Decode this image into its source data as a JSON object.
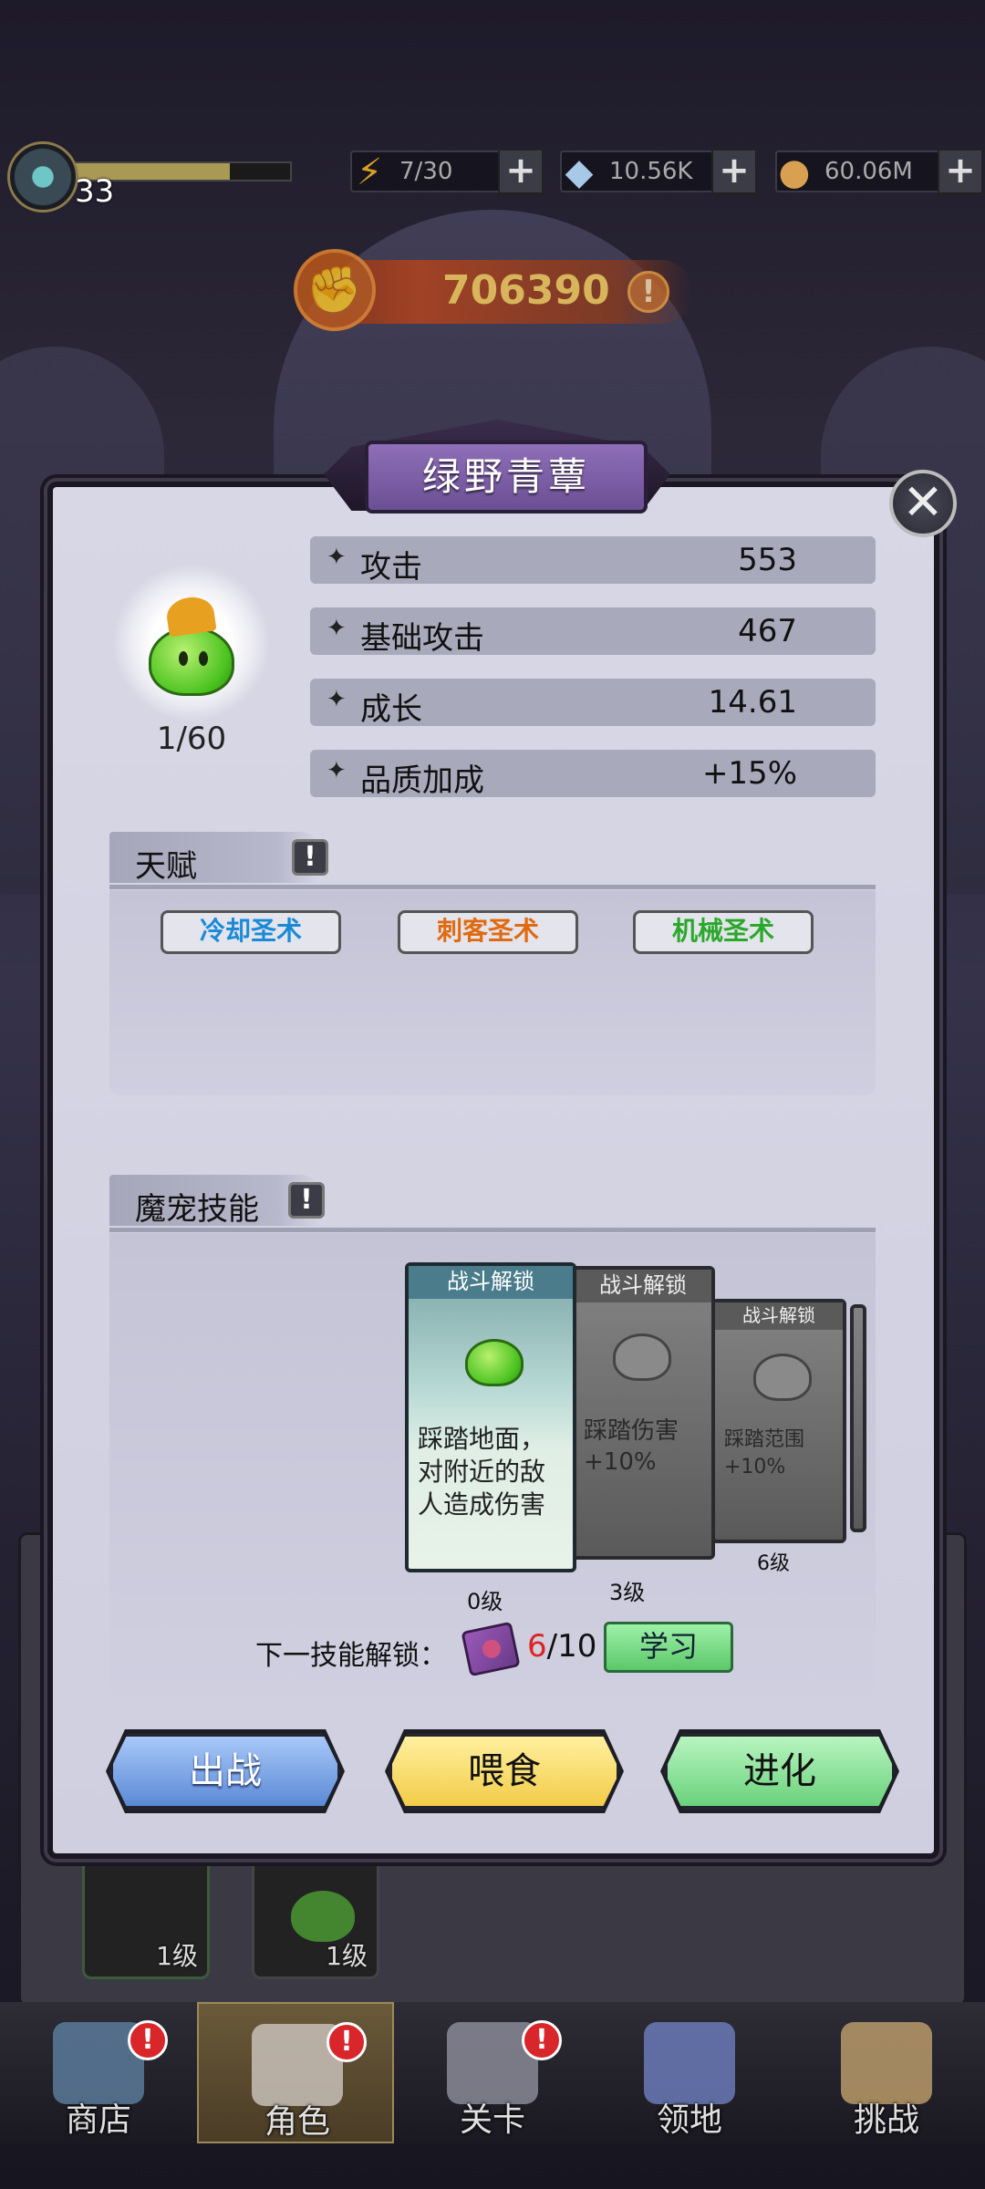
{
  "hud": {
    "level": "33",
    "xp_fraction": 0.72,
    "energy": "7/30",
    "gems": "10.56K",
    "coins": "60.06M"
  },
  "power": {
    "value": "706390"
  },
  "modal": {
    "title": "绿野青蕈",
    "pet_count": "1/60",
    "stats": [
      {
        "name": "攻击",
        "value": "553"
      },
      {
        "name": "基础攻击",
        "value": "467"
      },
      {
        "name": "成长",
        "value": "14.61"
      },
      {
        "name": "品质加成",
        "value": "+15%"
      }
    ],
    "talent_section": {
      "label": "天赋",
      "talents": [
        {
          "label": "冷却圣术",
          "color": "#1a8ad8"
        },
        {
          "label": "刺客圣术",
          "color": "#e06a10"
        },
        {
          "label": "机械圣术",
          "color": "#2aa82a"
        }
      ]
    },
    "skill_section": {
      "label": "魔宠技能",
      "cards": [
        {
          "header": "战斗解锁",
          "desc": "踩踏地面，对附近的敌人造成伤害",
          "level": "0级"
        },
        {
          "header": "战斗解锁",
          "desc": "踩踏伤害+10%",
          "level": "3级"
        },
        {
          "header": "战斗解锁",
          "desc": "踩踏范围+10%",
          "level": "6级"
        }
      ],
      "next_unlock_label": "下一技能解锁：",
      "unlock_current": "6",
      "unlock_total": "/10",
      "learn_label": "学习"
    },
    "buttons": {
      "battle": "出战",
      "feed": "喂食",
      "evolve": "进化"
    }
  },
  "background_slots": [
    {
      "level": "1级"
    },
    {
      "level": "1级"
    }
  ],
  "nav": [
    {
      "label": "商店",
      "badge": "!"
    },
    {
      "label": "角色",
      "badge": "!"
    },
    {
      "label": "关卡",
      "badge": "!"
    },
    {
      "label": "领地",
      "badge": ""
    },
    {
      "label": "挑战",
      "badge": ""
    }
  ]
}
